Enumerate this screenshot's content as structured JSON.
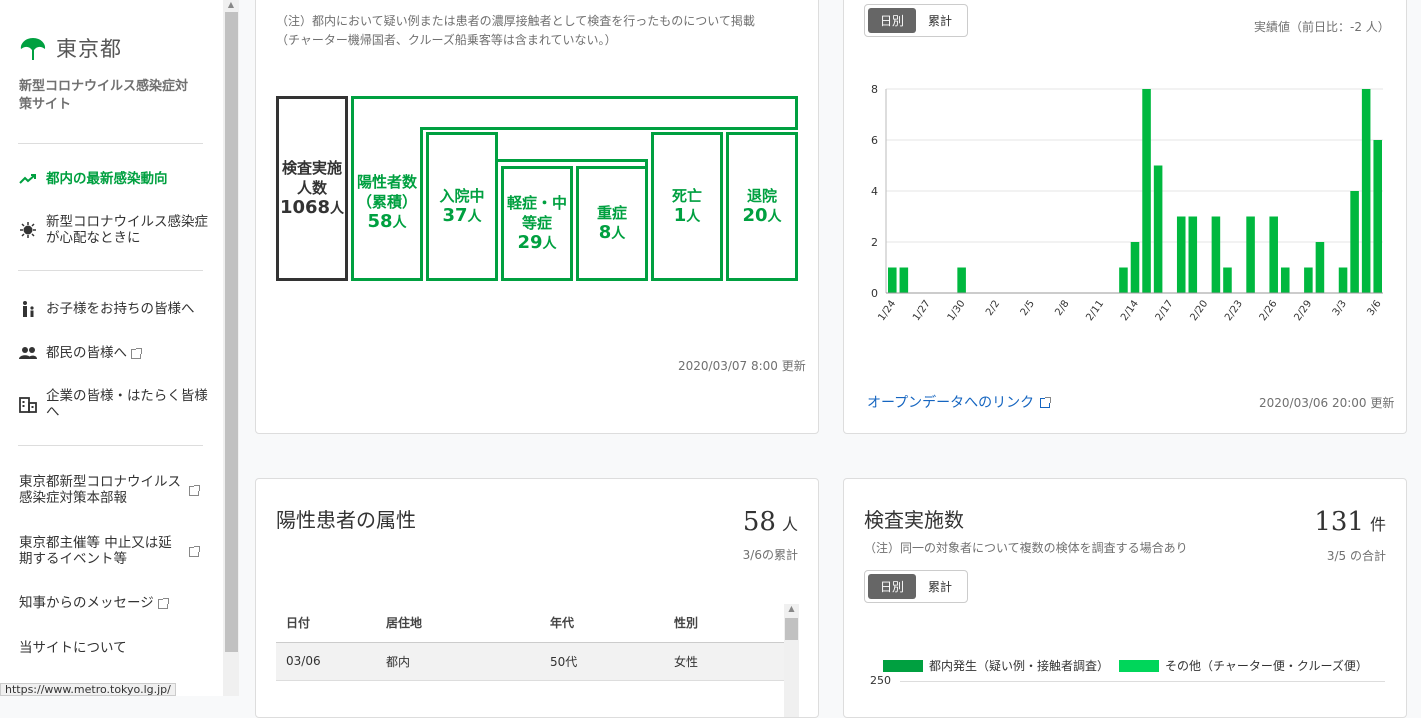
{
  "sidebar": {
    "logo_text": "東京都",
    "site_name": "新型コロナウイルス感染症対策サイト",
    "nav": [
      {
        "label": "都内の最新感染動向",
        "icon": "trend-icon"
      },
      {
        "label": "新型コロナウイルス感染症が心配なときに",
        "icon": "virus-icon"
      },
      {
        "label": "お子様をお持ちの皆様へ",
        "icon": "parent-child-icon"
      },
      {
        "label": "都民の皆様へ",
        "icon": "people-icon"
      },
      {
        "label": "企業の皆様・はたらく皆様へ",
        "icon": "building-icon"
      }
    ],
    "links": [
      {
        "label": "東京都新型コロナウイルス感染症対策本部報"
      },
      {
        "label": "東京都主催等 中止又は延期するイベント等"
      },
      {
        "label": "知事からのメッセージ"
      },
      {
        "label": "当サイトについて"
      }
    ]
  },
  "status_url": "https://www.metro.tokyo.lg.jp/",
  "test_card": {
    "note": "（注）都内において疑い例または患者の濃厚接触者として検査を行ったものについて掲載（チャーター機帰国者、クルーズ船乗客等は含まれていない。）",
    "boxes": {
      "tests": {
        "label": "検査実施人数",
        "value": "1068",
        "unit": "人"
      },
      "positive": {
        "label": "陽性者数（累積）",
        "value": "58",
        "unit": "人"
      },
      "hospital": {
        "label": "入院中",
        "value": "37",
        "unit": "人"
      },
      "mild": {
        "label": "軽症・中等症",
        "value": "29",
        "unit": "人"
      },
      "severe": {
        "label": "重症",
        "value": "8",
        "unit": "人"
      },
      "death": {
        "label": "死亡",
        "value": "1",
        "unit": "人"
      },
      "discharged": {
        "label": "退院",
        "value": "20",
        "unit": "人"
      }
    },
    "updated": "2020/03/07 8:00 更新"
  },
  "positive_chart_card": {
    "toggle": [
      "日別",
      "累計"
    ],
    "sub": "実績値（前日比：-2 人）",
    "open_data_link": "オープンデータへのリンク",
    "updated": "2020/03/06 20:00 更新"
  },
  "attributes_card": {
    "title": "陽性患者の属性",
    "total": "58",
    "unit": "人",
    "sub": "3/6の累計",
    "columns": [
      "日付",
      "居住地",
      "年代",
      "性別"
    ],
    "rows": [
      [
        "03/06",
        "都内",
        "50代",
        "女性"
      ]
    ]
  },
  "inspection_card": {
    "title": "検査実施数",
    "total": "131",
    "unit": "件",
    "note": "（注）同一の対象者について複数の検体を調査する場合あり",
    "sub": "3/5 の合計",
    "toggle": [
      "日別",
      "累計"
    ],
    "legend": [
      "都内発生（疑い例・接触者調査）",
      "その他（チャーター便・クルーズ便）"
    ],
    "y_top": "250",
    "colors": {
      "series1": "#00a040",
      "series2": "#00d65a"
    }
  },
  "chart_data": {
    "type": "bar",
    "x": [
      "1/24",
      "1/25",
      "1/26",
      "1/27",
      "1/28",
      "1/29",
      "1/30",
      "1/31",
      "2/1",
      "2/2",
      "2/3",
      "2/4",
      "2/5",
      "2/6",
      "2/7",
      "2/8",
      "2/9",
      "2/10",
      "2/11",
      "2/12",
      "2/13",
      "2/14",
      "2/15",
      "2/16",
      "2/17",
      "2/18",
      "2/19",
      "2/20",
      "2/21",
      "2/22",
      "2/23",
      "2/24",
      "2/25",
      "2/26",
      "2/27",
      "2/28",
      "2/29",
      "3/1",
      "3/2",
      "3/3",
      "3/4",
      "3/5",
      "3/6"
    ],
    "values": [
      1,
      1,
      0,
      0,
      0,
      0,
      1,
      0,
      0,
      0,
      0,
      0,
      0,
      0,
      0,
      0,
      0,
      0,
      0,
      0,
      1,
      2,
      8,
      5,
      0,
      3,
      3,
      0,
      3,
      1,
      0,
      3,
      0,
      3,
      1,
      0,
      1,
      2,
      0,
      1,
      4,
      8,
      6
    ],
    "tick_labels": [
      "1/24",
      "1/27",
      "1/30",
      "2/2",
      "2/5",
      "2/8",
      "2/11",
      "2/14",
      "2/17",
      "2/20",
      "2/23",
      "2/26",
      "2/29",
      "3/3",
      "3/6"
    ],
    "yticks": [
      "0",
      "2",
      "4",
      "6",
      "8"
    ],
    "ylim": [
      0,
      8
    ],
    "color": "#00b83f",
    "grid": true
  }
}
